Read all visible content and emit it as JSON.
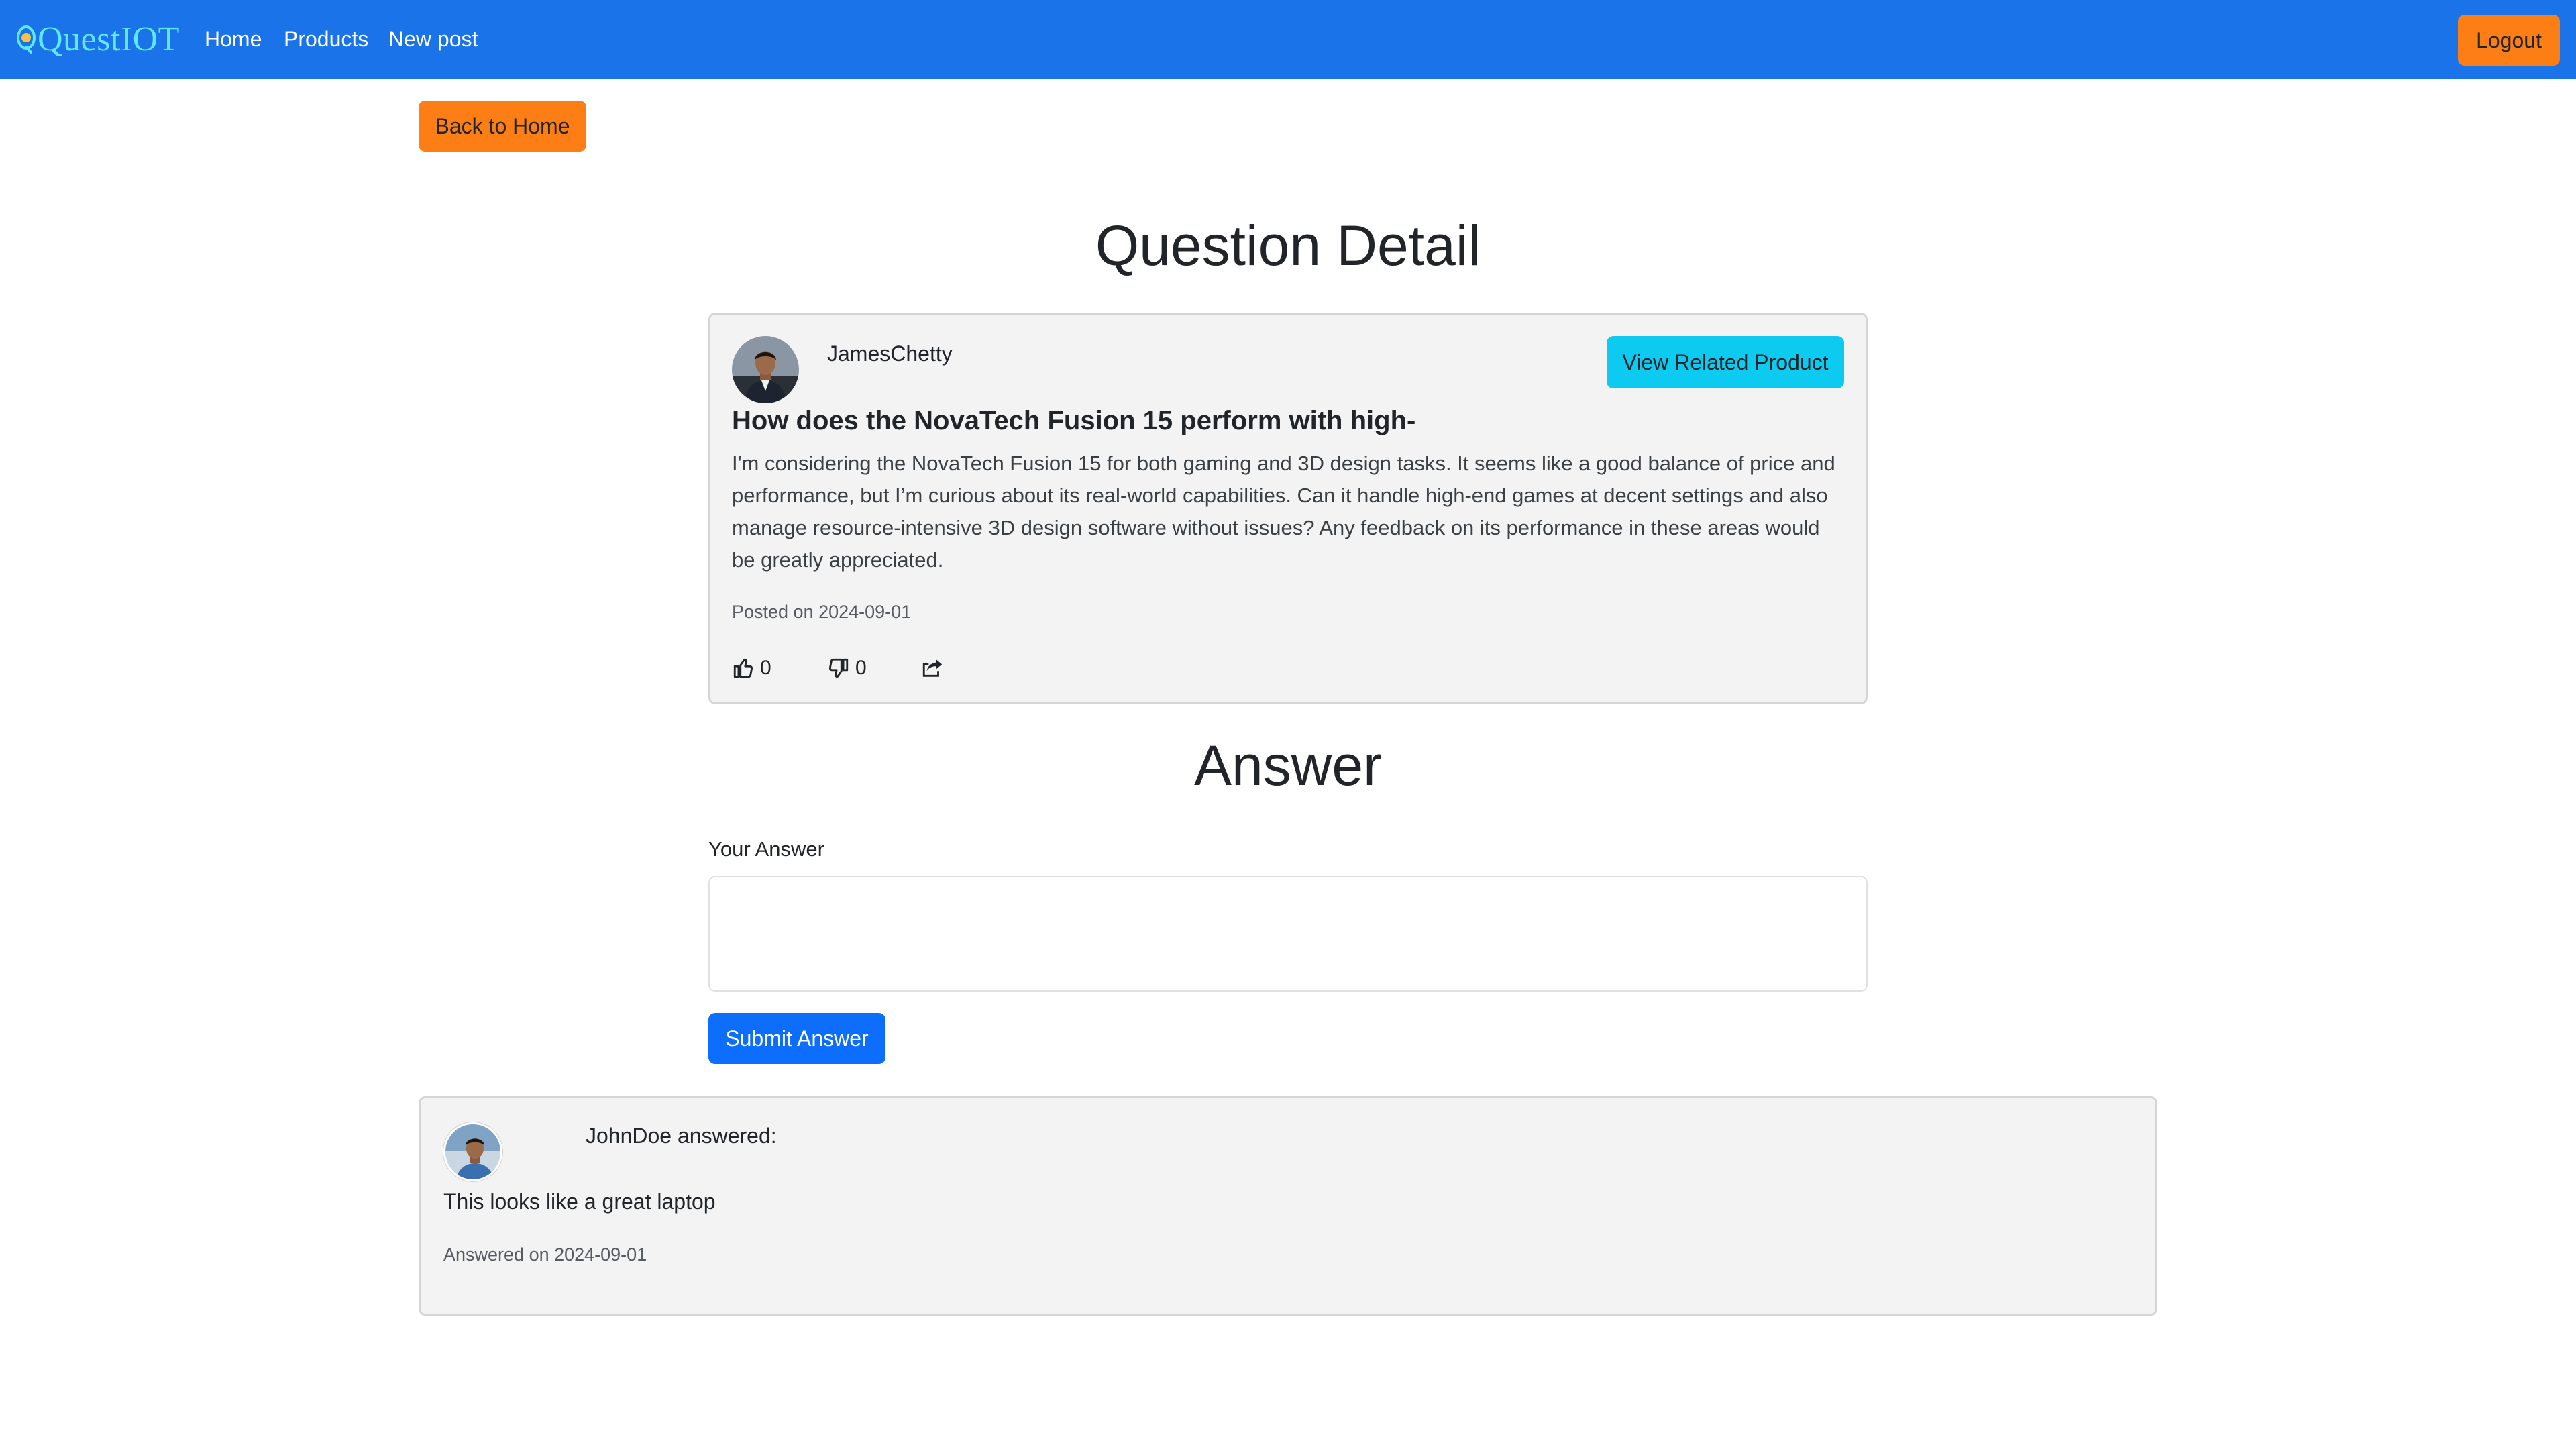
{
  "navbar": {
    "brand": "QuestIOT",
    "links": [
      "Home",
      "Products",
      "New post"
    ],
    "logout_label": "Logout"
  },
  "back_label": "Back to Home",
  "question_section": {
    "title": "Question Detail",
    "author": "JamesChetty",
    "related_button": "View Related Product",
    "heading": "How does the NovaTech Fusion 15 perform with high-",
    "body": "I'm considering the NovaTech Fusion 15 for both gaming and 3D design tasks. It seems like a good balance of price and performance, but I’m curious about its real-world capabilities. Can it handle high-end games at decent settings and also manage resource-intensive 3D design software without issues? Any feedback on its performance in these areas would be greatly appreciated.",
    "posted": "Posted on 2024-09-01",
    "likes": "0",
    "dislikes": "0"
  },
  "answer_section": {
    "title": "Answer",
    "label": "Your Answer",
    "input_value": "",
    "submit_label": "Submit Answer"
  },
  "answers": [
    {
      "author_line": "JohnDoe answered:",
      "body": "This looks like a great laptop",
      "meta": "Answered on 2024-09-01"
    }
  ],
  "colors": {
    "navbar": "#1a73e8",
    "brand_text": "#5ee7ff",
    "orange_button": "#fd7e14",
    "info_button": "#0dcaf0",
    "primary_button": "#0d6efd",
    "card_background": "#f3f3f3"
  },
  "icons": [
    "brand-logo-icon",
    "thumbs-up-icon",
    "thumbs-down-icon",
    "share-icon"
  ]
}
